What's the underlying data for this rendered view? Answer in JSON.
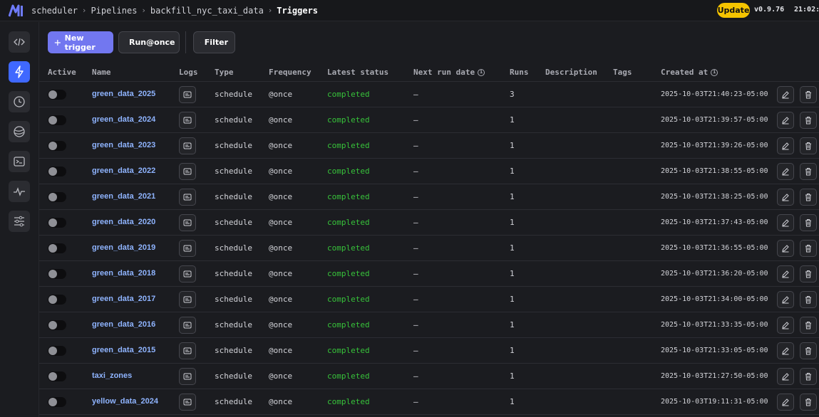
{
  "breadcrumb": [
    "scheduler",
    "Pipelines",
    "backfill_nyc_taxi_data",
    "Triggers"
  ],
  "header": {
    "update_label": "Update",
    "version": "v0.9.76",
    "clock": "21:02:"
  },
  "toolbar": {
    "new_trigger": "New trigger",
    "run_once": "Run@once",
    "filter": "Filter"
  },
  "columns": {
    "active": "Active",
    "name": "Name",
    "logs": "Logs",
    "type": "Type",
    "frequency": "Frequency",
    "latest_status": "Latest status",
    "next_run_date": "Next run date",
    "runs": "Runs",
    "description": "Description",
    "tags": "Tags",
    "created_at": "Created at"
  },
  "colors": {
    "accent": "#7277f0",
    "active_nav": "#3f68ff",
    "status_completed": "#37c23a",
    "name_link": "#8fb4ff",
    "update": "#f5c400"
  },
  "icons": {
    "sidebar": [
      "code-icon",
      "lightning-icon",
      "clock-icon",
      "globe-icon",
      "terminal-icon",
      "activity-icon",
      "settings-sliders-icon"
    ],
    "row_actions": [
      "logs-icon",
      "edit-icon",
      "trash-icon"
    ]
  },
  "rows": [
    {
      "name": "green_data_2025",
      "type": "schedule",
      "frequency": "@once",
      "status": "completed",
      "next_run": "–",
      "runs": "3",
      "created": "2025-10-03T21:40:23-05:00"
    },
    {
      "name": "green_data_2024",
      "type": "schedule",
      "frequency": "@once",
      "status": "completed",
      "next_run": "–",
      "runs": "1",
      "created": "2025-10-03T21:39:57-05:00"
    },
    {
      "name": "green_data_2023",
      "type": "schedule",
      "frequency": "@once",
      "status": "completed",
      "next_run": "–",
      "runs": "1",
      "created": "2025-10-03T21:39:26-05:00"
    },
    {
      "name": "green_data_2022",
      "type": "schedule",
      "frequency": "@once",
      "status": "completed",
      "next_run": "–",
      "runs": "1",
      "created": "2025-10-03T21:38:55-05:00"
    },
    {
      "name": "green_data_2021",
      "type": "schedule",
      "frequency": "@once",
      "status": "completed",
      "next_run": "–",
      "runs": "1",
      "created": "2025-10-03T21:38:25-05:00"
    },
    {
      "name": "green_data_2020",
      "type": "schedule",
      "frequency": "@once",
      "status": "completed",
      "next_run": "–",
      "runs": "1",
      "created": "2025-10-03T21:37:43-05:00"
    },
    {
      "name": "green_data_2019",
      "type": "schedule",
      "frequency": "@once",
      "status": "completed",
      "next_run": "–",
      "runs": "1",
      "created": "2025-10-03T21:36:55-05:00"
    },
    {
      "name": "green_data_2018",
      "type": "schedule",
      "frequency": "@once",
      "status": "completed",
      "next_run": "–",
      "runs": "1",
      "created": "2025-10-03T21:36:20-05:00"
    },
    {
      "name": "green_data_2017",
      "type": "schedule",
      "frequency": "@once",
      "status": "completed",
      "next_run": "–",
      "runs": "1",
      "created": "2025-10-03T21:34:00-05:00"
    },
    {
      "name": "green_data_2016",
      "type": "schedule",
      "frequency": "@once",
      "status": "completed",
      "next_run": "–",
      "runs": "1",
      "created": "2025-10-03T21:33:35-05:00"
    },
    {
      "name": "green_data_2015",
      "type": "schedule",
      "frequency": "@once",
      "status": "completed",
      "next_run": "–",
      "runs": "1",
      "created": "2025-10-03T21:33:05-05:00"
    },
    {
      "name": "taxi_zones",
      "type": "schedule",
      "frequency": "@once",
      "status": "completed",
      "next_run": "–",
      "runs": "1",
      "created": "2025-10-03T21:27:50-05:00"
    },
    {
      "name": "yellow_data_2024",
      "type": "schedule",
      "frequency": "@once",
      "status": "completed",
      "next_run": "–",
      "runs": "1",
      "created": "2025-10-03T19:11:31-05:00"
    }
  ]
}
